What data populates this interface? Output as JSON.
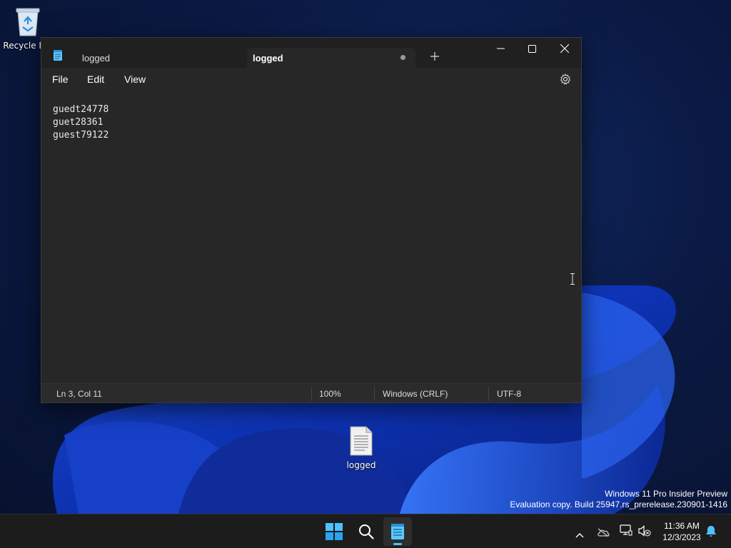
{
  "desktop": {
    "icons": [
      {
        "label": "Recycle Bin",
        "icon": "recycle-bin-icon"
      },
      {
        "label": "logged",
        "icon": "text-file-icon"
      }
    ],
    "watermark": {
      "line1": "Windows 11 Pro Insider Preview",
      "line2": "Evaluation copy. Build 25947.rs_prerelease.230901-1416"
    }
  },
  "notepad": {
    "tabs": [
      {
        "label": "logged",
        "active": false
      },
      {
        "label": "logged",
        "active": true,
        "unsaved": true
      }
    ],
    "menu": [
      "File",
      "Edit",
      "View"
    ],
    "content": [
      "guedt24778",
      "guet28361",
      "guest79122"
    ],
    "status": {
      "position": "Ln 3, Col 11",
      "zoom": "100%",
      "line_ending": "Windows (CRLF)",
      "encoding": "UTF-8"
    }
  },
  "taskbar": {
    "apps": [
      "start-icon",
      "search-icon",
      "notepad-icon"
    ],
    "tray": [
      "chevron-up-icon",
      "onedrive-icon",
      "network-icon",
      "volume-muted-icon",
      "notification-bell-icon"
    ],
    "time": "11:36 AM",
    "date": "12/3/2023",
    "accent": "#4cc2ff"
  }
}
